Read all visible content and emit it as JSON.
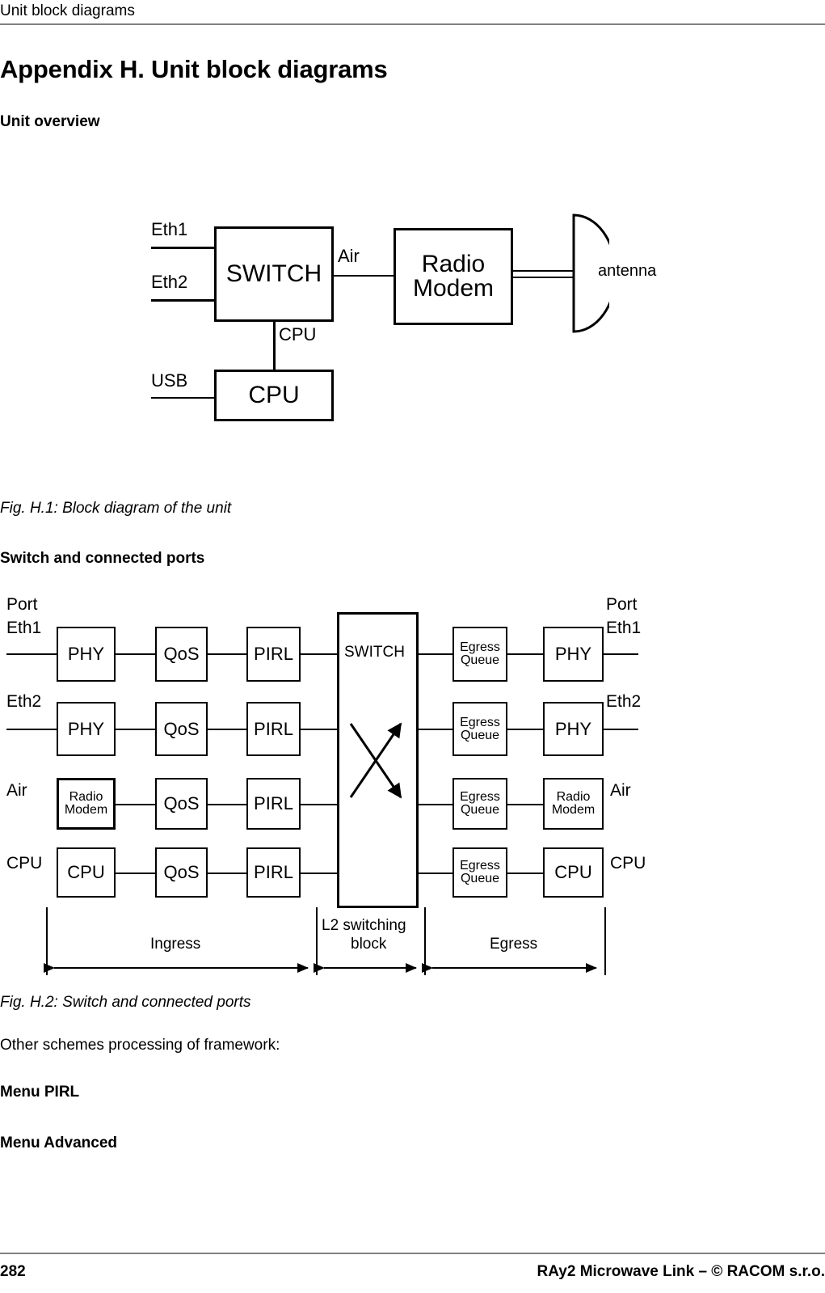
{
  "header": {
    "running_title": "Unit block diagrams"
  },
  "headings": {
    "appendix_title": "Appendix H. Unit block diagrams",
    "unit_overview": "Unit overview",
    "switch_ports": "Switch and connected ports",
    "menu_pirl": "Menu PIRL",
    "menu_advanced": "Menu Advanced"
  },
  "body": {
    "other_schemes": "Other schemes processing of framework:"
  },
  "captions": {
    "fig_h1": "Fig. H.1: Block diagram of the unit",
    "fig_h2": "Fig. H.2: Switch and connected ports"
  },
  "footer": {
    "page_number": "282",
    "copyright": "RAy2 Microwave Link – © RACOM s.r.o."
  },
  "figure1": {
    "title": "Block diagram of the unit",
    "boxes": {
      "switch": "SWITCH",
      "radio_modem_line1": "Radio",
      "radio_modem_line2": "Modem",
      "cpu": "CPU"
    },
    "port_labels": {
      "eth1": "Eth1",
      "eth2": "Eth2",
      "usb": "USB"
    },
    "link_labels": {
      "air": "Air",
      "cpu": "CPU",
      "antenna": "antenna"
    }
  },
  "figure2": {
    "title": "Switch and connected ports",
    "center_block": "SWITCH",
    "left_port_caption": "Port",
    "right_port_caption": "Port",
    "rows": [
      {
        "left_label": "Eth1",
        "ingress_first": "PHY",
        "ingress_first_line2": "",
        "qos": "QoS",
        "pirl": "PIRL",
        "egress_queue_line1": "Egress",
        "egress_queue_line2": "Queue",
        "egress_last": "PHY",
        "egress_last_line2": "",
        "right_label": "Eth1"
      },
      {
        "left_label": "Eth2",
        "ingress_first": "PHY",
        "ingress_first_line2": "",
        "qos": "QoS",
        "pirl": "PIRL",
        "egress_queue_line1": "Egress",
        "egress_queue_line2": "Queue",
        "egress_last": "PHY",
        "egress_last_line2": "",
        "right_label": "Eth2"
      },
      {
        "left_label": "Air",
        "ingress_first": "Radio",
        "ingress_first_line2": "Modem",
        "qos": "QoS",
        "pirl": "PIRL",
        "egress_queue_line1": "Egress",
        "egress_queue_line2": "Queue",
        "egress_last": "Radio",
        "egress_last_line2": "Modem",
        "right_label": "Air"
      },
      {
        "left_label": "CPU",
        "ingress_first": "CPU",
        "ingress_first_line2": "",
        "qos": "QoS",
        "pirl": "PIRL",
        "egress_queue_line1": "Egress",
        "egress_queue_line2": "Queue",
        "egress_last": "CPU",
        "egress_last_line2": "",
        "right_label": "CPU"
      }
    ],
    "axis_labels": {
      "ingress": "Ingress",
      "l2_switching_line1": "L2 switching",
      "l2_switching_line2": "block",
      "egress": "Egress"
    }
  },
  "colors": {
    "ink": "#000000",
    "rule": "#808080",
    "paper": "#ffffff"
  }
}
